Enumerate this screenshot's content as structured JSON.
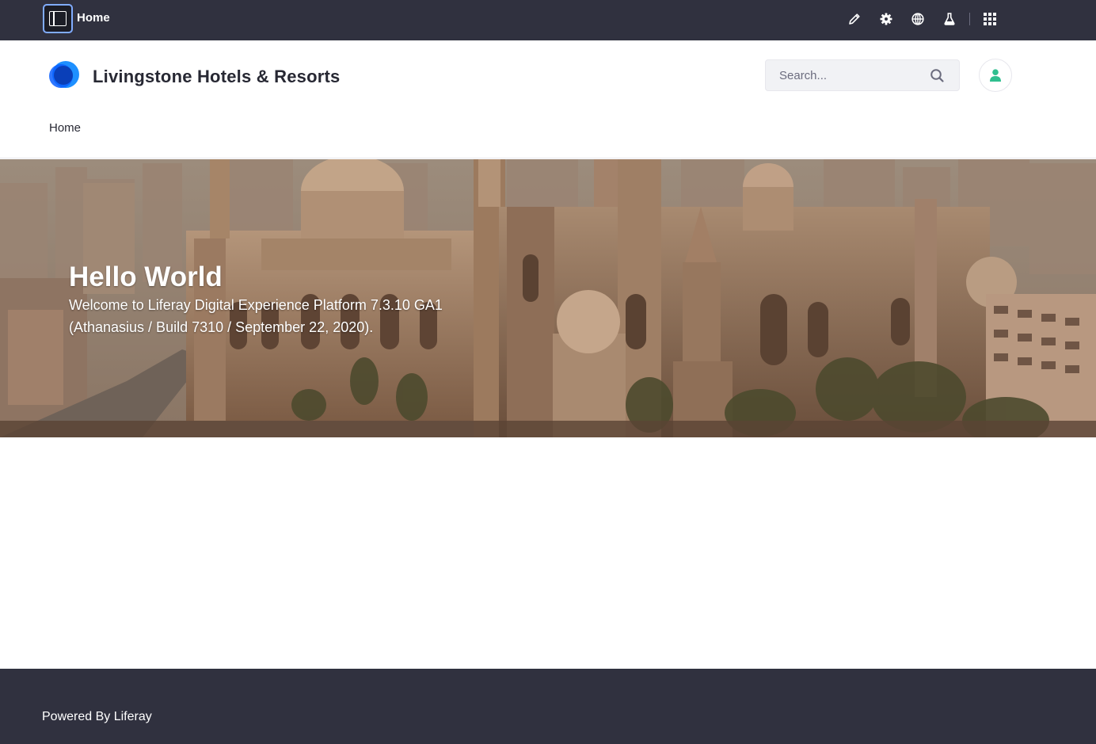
{
  "control_menu": {
    "title": "Home",
    "icons": [
      "pencil-icon",
      "gear-icon",
      "globe-icon",
      "flask-icon",
      "apps-grid-icon"
    ]
  },
  "header": {
    "site_name": "Livingstone Hotels & Resorts",
    "search": {
      "placeholder": "Search...",
      "value": ""
    },
    "breadcrumb": "Home"
  },
  "hero": {
    "title": "Hello World",
    "text": "Welcome to Liferay Digital Experience Platform 7.3.10 GA1 (Athanasius / Build 7310 / September 22, 2020)."
  },
  "footer": {
    "text": "Powered By Liferay"
  },
  "colors": {
    "control_menu_bg": "#30313f",
    "footer_bg": "#30313f",
    "brand_blue": "#0b5fff",
    "avatar_green": "#2fbf8f"
  }
}
